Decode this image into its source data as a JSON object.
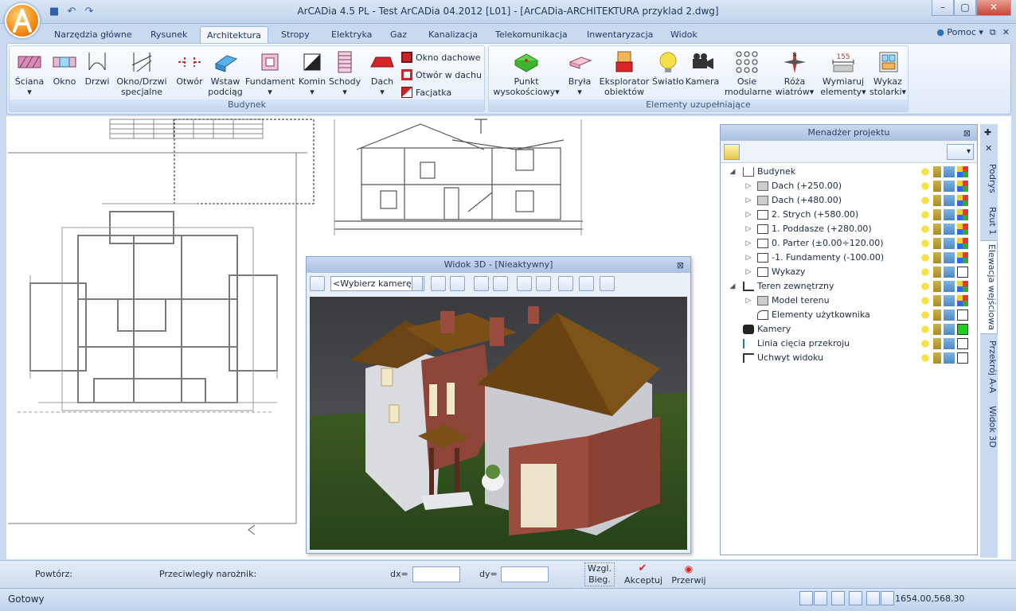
{
  "titlebar": {
    "title": "ArCADia 4.5 PL - Test ArCADia 04.2012 [L01] - [ArCADia-ARCHITEKTURA przyklad 2.dwg]"
  },
  "tabs": [
    {
      "label": "Narzędzia główne"
    },
    {
      "label": "Rysunek"
    },
    {
      "label": "Architektura",
      "active": true
    },
    {
      "label": "Stropy"
    },
    {
      "label": "Elektryka"
    },
    {
      "label": "Gaz"
    },
    {
      "label": "Kanalizacja"
    },
    {
      "label": "Telekomunikacja"
    },
    {
      "label": "Inwentaryzacja"
    },
    {
      "label": "Widok"
    }
  ],
  "help": {
    "label": "Pomoc"
  },
  "ribbon": {
    "groups": {
      "budynek": "Budynek",
      "elementy": "Elementy uzupełniające"
    },
    "buttons": {
      "sciana": "Ściana",
      "okno": "Okno",
      "drzwi": "Drzwi",
      "okno_drzwi_1": "Okno/Drzwi",
      "okno_drzwi_2": "specjalne",
      "otwor": "Otwór",
      "wstaw_1": "Wstaw",
      "wstaw_2": "podciąg",
      "fundament": "Fundament",
      "komin": "Komin",
      "schody": "Schody",
      "dach": "Dach",
      "okno_dachowe": "Okno dachowe",
      "otwor_w_dachu": "Otwór w dachu",
      "facjatka": "Facjatka",
      "punkt_1": "Punkt",
      "punkt_2": "wysokościowy",
      "bryla": "Bryła",
      "eksplorator_1": "Eksplorator",
      "eksplorator_2": "obiektów",
      "swiatlo": "Światło",
      "kamera": "Kamera",
      "osie_1": "Osie",
      "osie_2": "modularne",
      "roza_1": "Róża",
      "roza_2": "wiatrów",
      "wymiaruj_1": "Wymiaruj",
      "wymiaruj_2": "elementy",
      "wymiaruj_num": "155",
      "wykaz_1": "Wykaz",
      "wykaz_2": "stolarki"
    }
  },
  "view3d": {
    "title": "Widok 3D - [Nieaktywny]",
    "camera_select": "<Wybierz kamerę>"
  },
  "project_manager": {
    "title": "Menadżer projektu",
    "tree": [
      {
        "label": "Budynek",
        "level": 0,
        "expanded": true
      },
      {
        "label": "Dach (+250.00)",
        "level": 1
      },
      {
        "label": "Dach (+480.00)",
        "level": 1
      },
      {
        "label": "2. Strych (+580.00)",
        "level": 1
      },
      {
        "label": "1. Poddasze (+280.00)",
        "level": 1
      },
      {
        "label": "0. Parter (±0.00÷120.00)",
        "level": 1
      },
      {
        "label": "-1. Fundamenty (-100.00)",
        "level": 1
      },
      {
        "label": "Wykazy",
        "level": 1
      },
      {
        "label": "Teren zewnętrzny",
        "level": 0,
        "expanded": true
      },
      {
        "label": "Model terenu",
        "level": 1
      },
      {
        "label": "Elementy użytkownika",
        "level": 1
      },
      {
        "label": "Kamery",
        "level": 0
      },
      {
        "label": "Linia cięcia przekroju",
        "level": 0
      },
      {
        "label": "Uchwyt widoku",
        "level": 0
      }
    ]
  },
  "side_tabs": [
    {
      "label": "Podrys"
    },
    {
      "label": "Rzut 1"
    },
    {
      "label": "Elewacja wejściowa",
      "active": true
    },
    {
      "label": "Przekrój A-A"
    },
    {
      "label": "Widok 3D"
    }
  ],
  "command_bar": {
    "repeat": "Powtórz:",
    "opposite": "Przeciwległy narożnik:",
    "dx": "dx=",
    "dy": "dy=",
    "wzgl": "Wzgl.",
    "bieg": "Bieg.",
    "accept": "Akceptuj",
    "cancel": "Przerwij"
  },
  "status": {
    "text": "Gotowy",
    "coords": "1654.00,568.30"
  }
}
